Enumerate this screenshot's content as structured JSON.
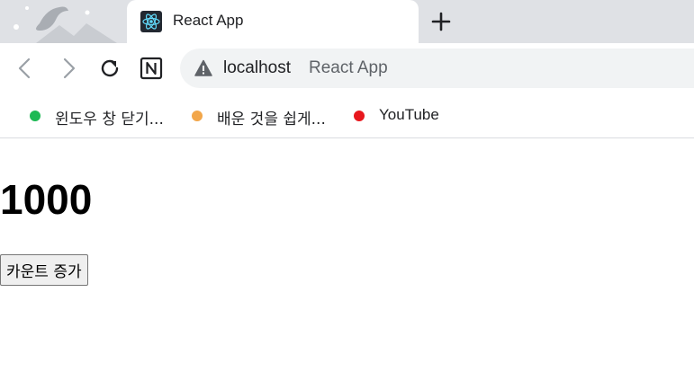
{
  "tab": {
    "title": "React App",
    "favicon": "react-icon"
  },
  "toolbar": {
    "back": "back-icon",
    "forward": "forward-icon",
    "reload": "reload-icon",
    "extension": "notion-icon"
  },
  "address_bar": {
    "security_icon": "warning-icon",
    "host": "localhost",
    "page_title": "React App"
  },
  "bookmarks": [
    {
      "label": "윈도우 창 닫기...",
      "color": "#1db954"
    },
    {
      "label": "배운 것을 쉽게...",
      "color": "#f2a64a"
    },
    {
      "label": "YouTube",
      "color": "#e8171d"
    }
  ],
  "page": {
    "count": "1000",
    "button_label": "카운트 증가"
  },
  "colors": {
    "tabstrip": "#dfe1e5",
    "omnibox": "#f1f3f4",
    "react_cyan": "#61dafb"
  }
}
